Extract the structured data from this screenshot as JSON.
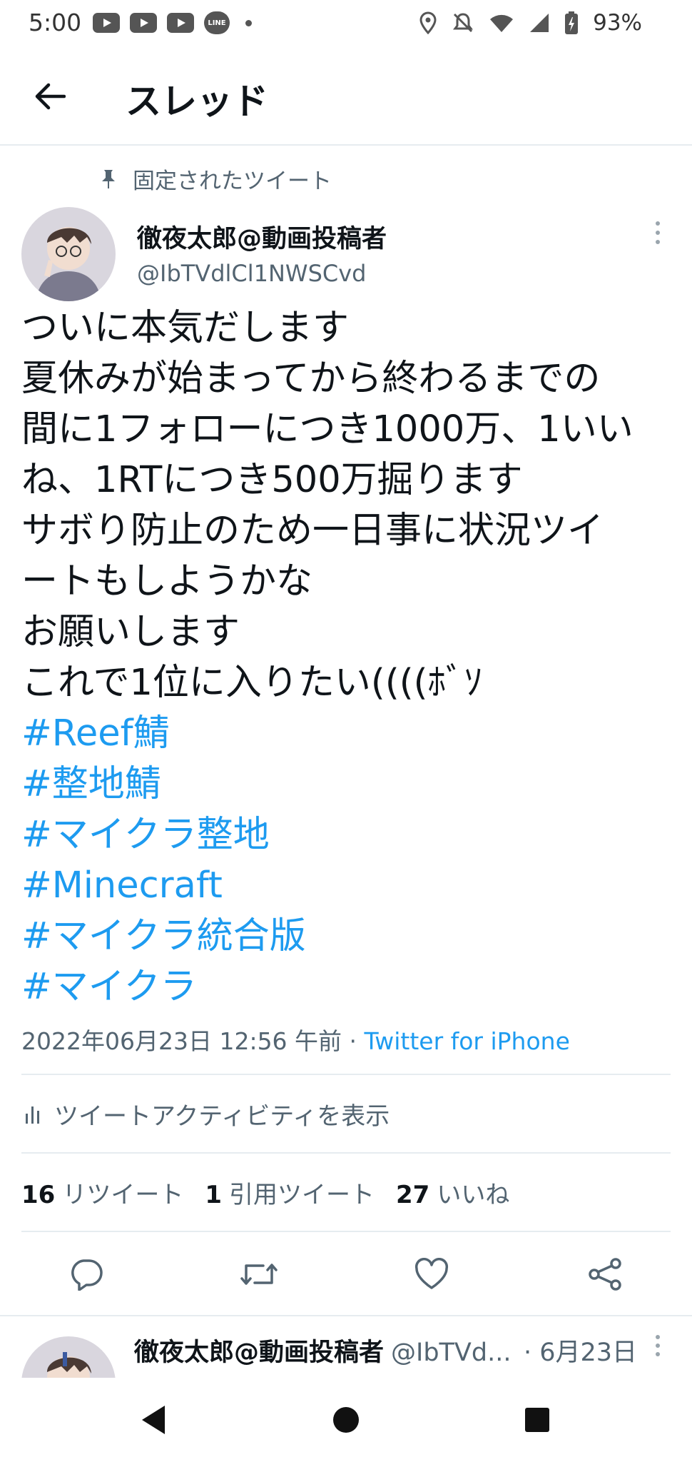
{
  "status_bar": {
    "time": "5:00",
    "line_label": "LINE",
    "battery": "93%"
  },
  "header": {
    "title": "スレッド"
  },
  "tweet": {
    "pinned_label": "固定されたツイート",
    "author": {
      "name": "徹夜太郎@動画投稿者",
      "handle": "@IbTVdlCl1NWSCvd"
    },
    "lines": [
      "ついに本気だします",
      "夏休みが始まってから終わるまでの",
      "間に1フォローにつき1000万、1いい",
      "ね、1RTにつき500万掘ります",
      "サボり防止のため一日事に状況ツイ",
      "ートもしようかな",
      "お願いします",
      "これで1位に入りたい((((ﾎﾞｿ"
    ],
    "hashtags": [
      "#Reef鯖",
      " #整地鯖",
      " #マイクラ整地",
      " #Minecraft",
      " #マイクラ統合版",
      " #マイクラ"
    ],
    "timestamp": "2022年06月23日 12:56 午前",
    "separator": " · ",
    "source": "Twitter for iPhone",
    "activity_label": "ツイートアクティビティを表示",
    "stats": {
      "retweets_count": "16",
      "retweets_label": "リツイート",
      "quotes_count": "1",
      "quotes_label": "引用ツイート",
      "likes_count": "27",
      "likes_label": "いいね"
    }
  },
  "reply": {
    "name": "徹夜太郎@動画投稿者",
    "handle": "@IbTVd...",
    "date": "· 6月23日"
  },
  "colors": {
    "link": "#1d9bf0",
    "secondary_text": "#536471",
    "divider": "#e6ecf0"
  }
}
